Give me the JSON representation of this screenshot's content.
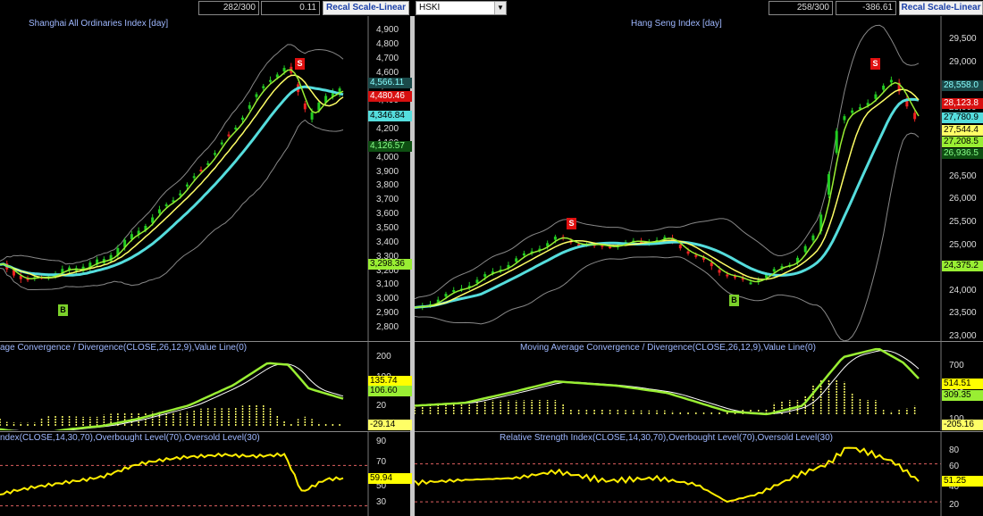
{
  "toolbar": {
    "left_counter": "282/300",
    "left_value": "0.11",
    "left_recal": "Recal Scale-Linear",
    "symbol": "HSKI",
    "right_counter": "258/300",
    "right_value": "-386.61",
    "right_recal": "Recal Scale-Linear"
  },
  "left": {
    "price_title": "Shanghai All Ordinaries Index [day]",
    "macd_title": "age Convergence / Divergence(CLOSE,26,12,9),Value Line(0)",
    "rsi_title": "ndex(CLOSE,14,30,70),Overbought Level(70),Oversold Level(30)",
    "price_ticks": [
      "4,900",
      "4,800",
      "4,700",
      "4,600",
      "4,500",
      "4,400",
      "4,300",
      "4,200",
      "4,100",
      "4,000",
      "3,900",
      "3,800",
      "3,700",
      "3,600",
      "3,500",
      "3,400",
      "3,300",
      "3,200",
      "3,100",
      "3,000",
      "2,900",
      "2,800"
    ],
    "price_labels": [
      "4,566.11",
      "4,480.46",
      "4,346.84",
      "4,126.57",
      "3,298.36"
    ],
    "macd_ticks": [
      "200",
      "100",
      "20"
    ],
    "macd_labels": [
      "135.74",
      "106.60",
      "-29.14"
    ],
    "rsi_ticks": [
      "90",
      "70",
      "50",
      "30"
    ],
    "rsi_labels": [
      "59.94"
    ],
    "signals": [
      "S",
      "B"
    ]
  },
  "right": {
    "price_title": "Hang Seng Index [day]",
    "macd_title": "Moving Average Convergence / Divergence(CLOSE,26,12,9),Value Line(0)",
    "rsi_title": "Relative Strength Index(CLOSE,14,30,70),Overbought Level(70),Oversold Level(30)",
    "price_ticks": [
      "29,500",
      "29,000",
      "28,500",
      "28,000",
      "27,500",
      "27,000",
      "26,500",
      "26,000",
      "25,500",
      "25,000",
      "24,500",
      "24,000",
      "23,500",
      "23,000"
    ],
    "price_labels": [
      "28,558.0",
      "28,123.8",
      "27,780.9",
      "27,544.4",
      "27,208.5",
      "26,936.5",
      "24,375.2"
    ],
    "macd_ticks": [
      "700",
      "300",
      "100"
    ],
    "macd_labels": [
      "514.51",
      "309.35",
      "-205.16"
    ],
    "rsi_ticks": [
      "80",
      "60",
      "40",
      "20"
    ],
    "rsi_labels": [
      "51.25"
    ],
    "signals": [
      "S",
      "S",
      "B"
    ]
  },
  "colors": {
    "up_candle": "#22cc22",
    "down_candle": "#ee2222",
    "ma_fast": "#99ee33",
    "ma_mid": "#ffff66",
    "ma_slow": "#55dddd",
    "bands": "#888888",
    "rsi": "#ffee00",
    "title": "#9fb8ff"
  }
}
